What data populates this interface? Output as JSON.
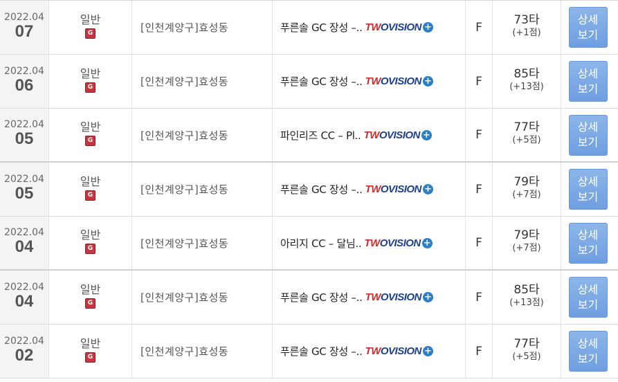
{
  "rounds": [
    {
      "year_month": "2022.04",
      "day": "07",
      "type": "일반",
      "badge": "G",
      "area": "[인천계양구]효성동",
      "course": "푸른솔 GC 장성 –..",
      "grade": "F",
      "score": "73타",
      "diff": "(+1점)",
      "btn_line1": "상세",
      "btn_line2": "보기"
    },
    {
      "year_month": "2022.04",
      "day": "06",
      "type": "일반",
      "badge": "G",
      "area": "[인천계양구]효성동",
      "course": "푸른솔 GC 장성 –..",
      "grade": "F",
      "score": "85타",
      "diff": "(+13점)",
      "btn_line1": "상세",
      "btn_line2": "보기"
    },
    {
      "year_month": "2022.04",
      "day": "05",
      "type": "일반",
      "badge": "G",
      "area": "[인천계양구]효성동",
      "course": "파인리즈 CC – Pl..",
      "grade": "F",
      "score": "77타",
      "diff": "(+5점)",
      "btn_line1": "상세",
      "btn_line2": "보기"
    },
    {
      "year_month": "2022.04",
      "day": "05",
      "type": "일반",
      "badge": "G",
      "area": "[인천계양구]효성동",
      "course": "푸른솔 GC 장성 –..",
      "grade": "F",
      "score": "79타",
      "diff": "(+7점)",
      "btn_line1": "상세",
      "btn_line2": "보기"
    },
    {
      "year_month": "2022.04",
      "day": "04",
      "type": "일반",
      "badge": "G",
      "area": "[인천계양구]효성동",
      "course": "아리지 CC – 달님..",
      "grade": "F",
      "score": "79타",
      "diff": "(+7점)",
      "btn_line1": "상세",
      "btn_line2": "보기"
    },
    {
      "year_month": "2022.04",
      "day": "04",
      "type": "일반",
      "badge": "G",
      "area": "[인천계양구]효성동",
      "course": "푸른솔 GC 장성 –..",
      "grade": "F",
      "score": "85타",
      "diff": "(+13점)",
      "btn_line1": "상세",
      "btn_line2": "보기"
    },
    {
      "year_month": "2022.04",
      "day": "02",
      "type": "일반",
      "badge": "G",
      "area": "[인천계양구]효성동",
      "course": "푸른솔 GC 장성 –..",
      "grade": "F",
      "score": "77타",
      "diff": "(+5점)",
      "btn_line1": "상세",
      "btn_line2": "보기"
    }
  ],
  "logo": {
    "tw": "TW",
    "rest": "OVISION",
    "plus": "+",
    "icon": "twovision-logo-icon"
  },
  "colors": {
    "button": "#7aa7e3",
    "badge": "#c8353f",
    "logo_blue": "#1d3f8f",
    "logo_red": "#d32a2a"
  }
}
